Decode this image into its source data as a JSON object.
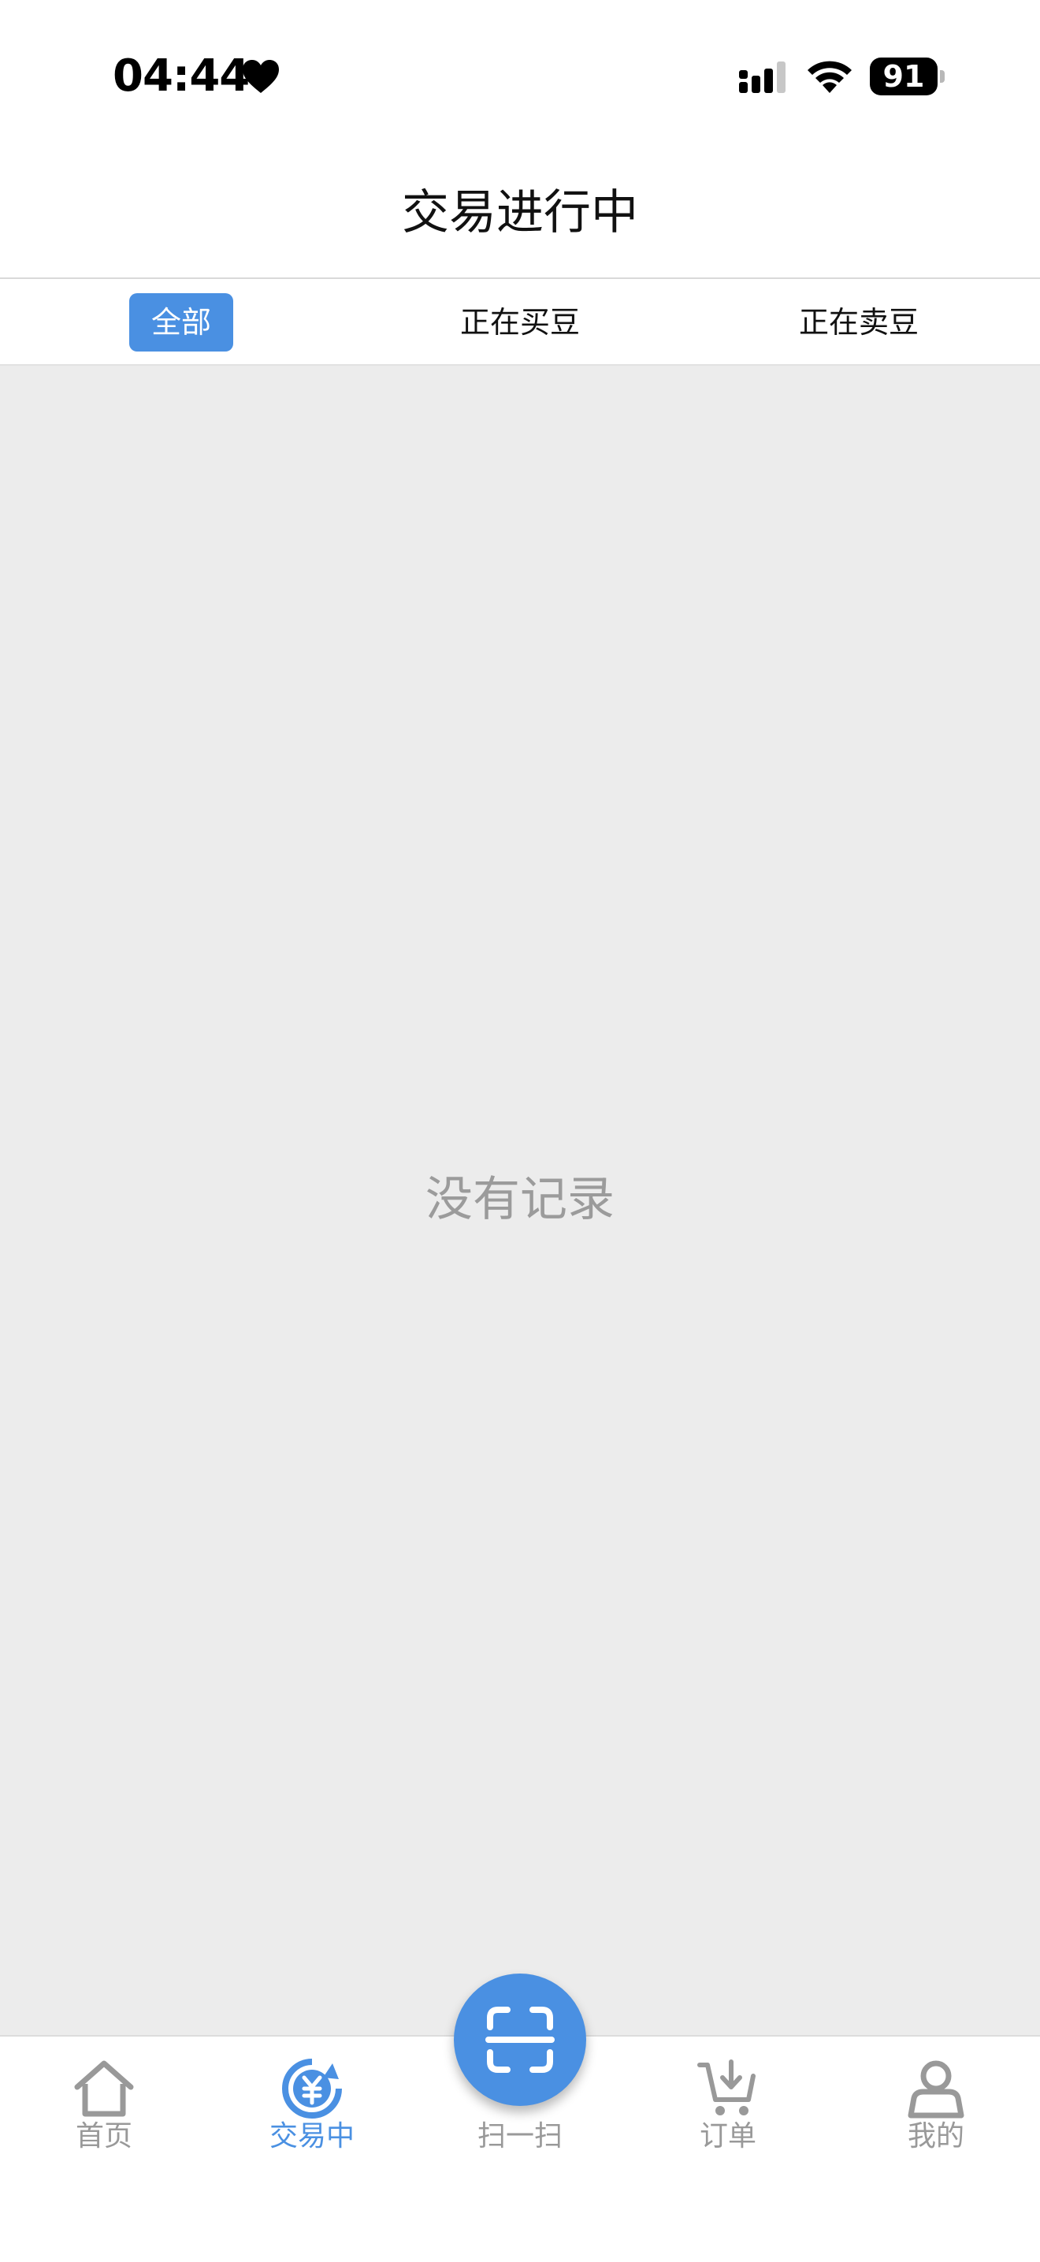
{
  "status_bar": {
    "time": "04:44",
    "battery_level": "91"
  },
  "header": {
    "title": "交易进行中"
  },
  "filter_tabs": [
    {
      "label": "全部",
      "active": true
    },
    {
      "label": "正在买豆",
      "active": false
    },
    {
      "label": "正在卖豆",
      "active": false
    }
  ],
  "content": {
    "empty_message": "没有记录"
  },
  "tab_bar": {
    "items": [
      {
        "label": "首页",
        "icon": "home-icon",
        "active": false
      },
      {
        "label": "交易中",
        "icon": "yuan-exchange-icon",
        "active": true
      },
      {
        "label": "扫一扫",
        "icon": "scan-icon",
        "active": false
      },
      {
        "label": "订单",
        "icon": "cart-icon",
        "active": false
      },
      {
        "label": "我的",
        "icon": "user-icon",
        "active": false
      }
    ]
  },
  "colors": {
    "accent": "#4a90e2",
    "inactive": "#999999",
    "background": "#ececec"
  }
}
